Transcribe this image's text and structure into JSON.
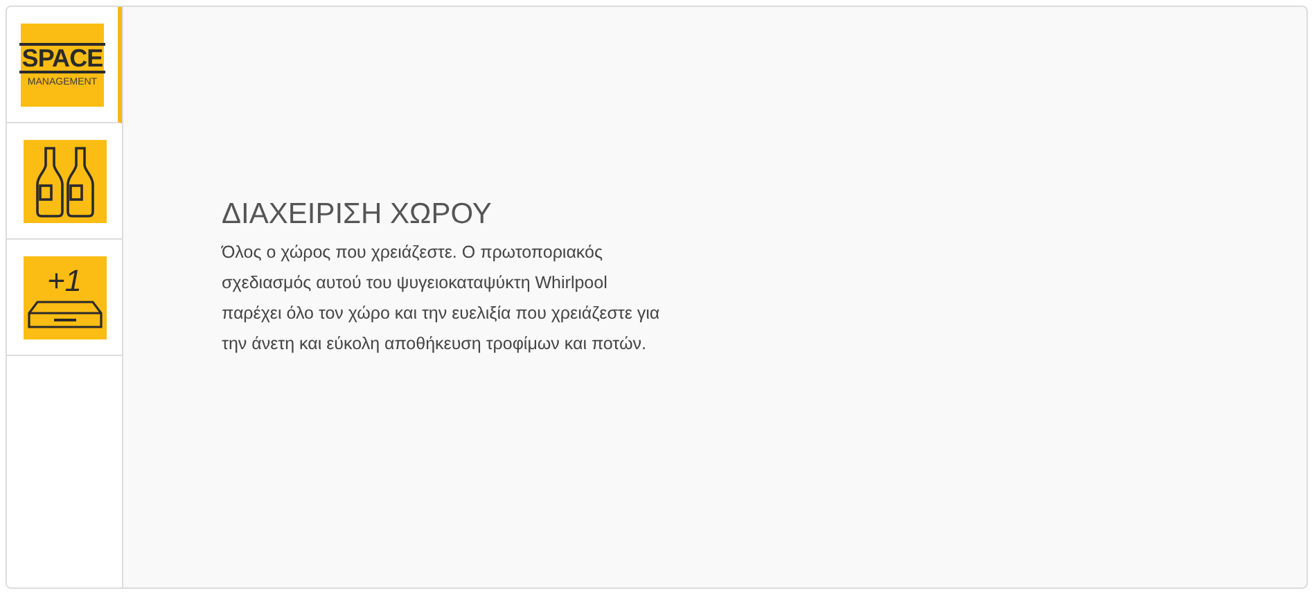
{
  "tabs": [
    {
      "kind": "logo",
      "selected": true,
      "word": "SPACE",
      "subword": "MANAGEMENT"
    },
    {
      "kind": "bottles",
      "selected": false
    },
    {
      "kind": "extra",
      "selected": false,
      "badge": "+1"
    }
  ],
  "content": {
    "title": "ΔΙΑΧΕΙΡΙΣΗ ΧΩΡΟΥ",
    "text": "Όλος ο χώρος που χρειάζεστε. Ο πρωτοποριακός σχεδιασμός αυτού του ψυγειοκαταψύκτη Whirlpool παρέχει όλο τον χώρο και την ευελιξία που χρειάζεστε για την άνετη και εύκολη αποθήκευση τροφίμων και ποτών."
  }
}
